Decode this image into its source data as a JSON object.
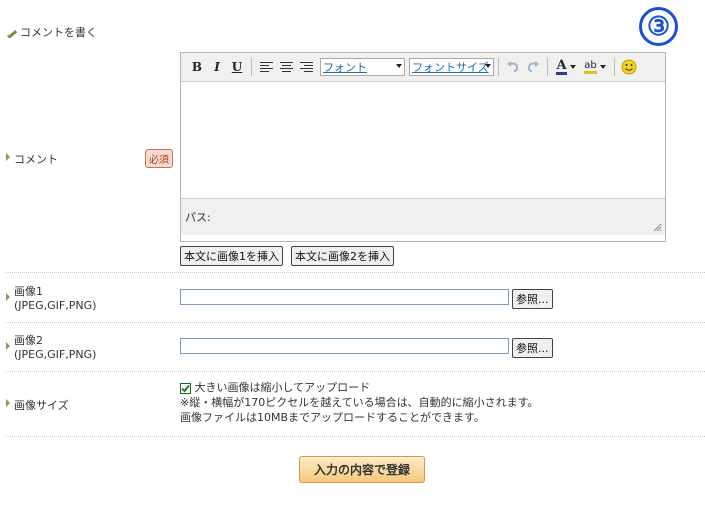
{
  "section_title": "コメントを書く",
  "step_number": "③",
  "comment": {
    "label": "コメント",
    "required": "必須",
    "toolbar": {
      "bold": "B",
      "italic": "I",
      "underline": "U",
      "font": "フォント",
      "font_size": "フォントサイズ",
      "text_color": "A",
      "highlight": "ab"
    },
    "path_label": "パス:",
    "insert_image1": "本文に画像1を挿入",
    "insert_image2": "本文に画像2を挿入"
  },
  "image1": {
    "label": "画像1",
    "formats": "(JPEG,GIF,PNG)",
    "browse": "参照..."
  },
  "image2": {
    "label": "画像2",
    "formats": "(JPEG,GIF,PNG)",
    "browse": "参照..."
  },
  "image_size": {
    "label": "画像サイズ",
    "checkbox_label": "大きい画像は縮小してアップロード",
    "checked": true,
    "note1": "※縦・横幅が170ピクセルを越えている場合は、自動的に縮小されます。",
    "note2": "画像ファイルは10MBまでアップロードすることができます。"
  },
  "submit": "入力の内容で登録"
}
